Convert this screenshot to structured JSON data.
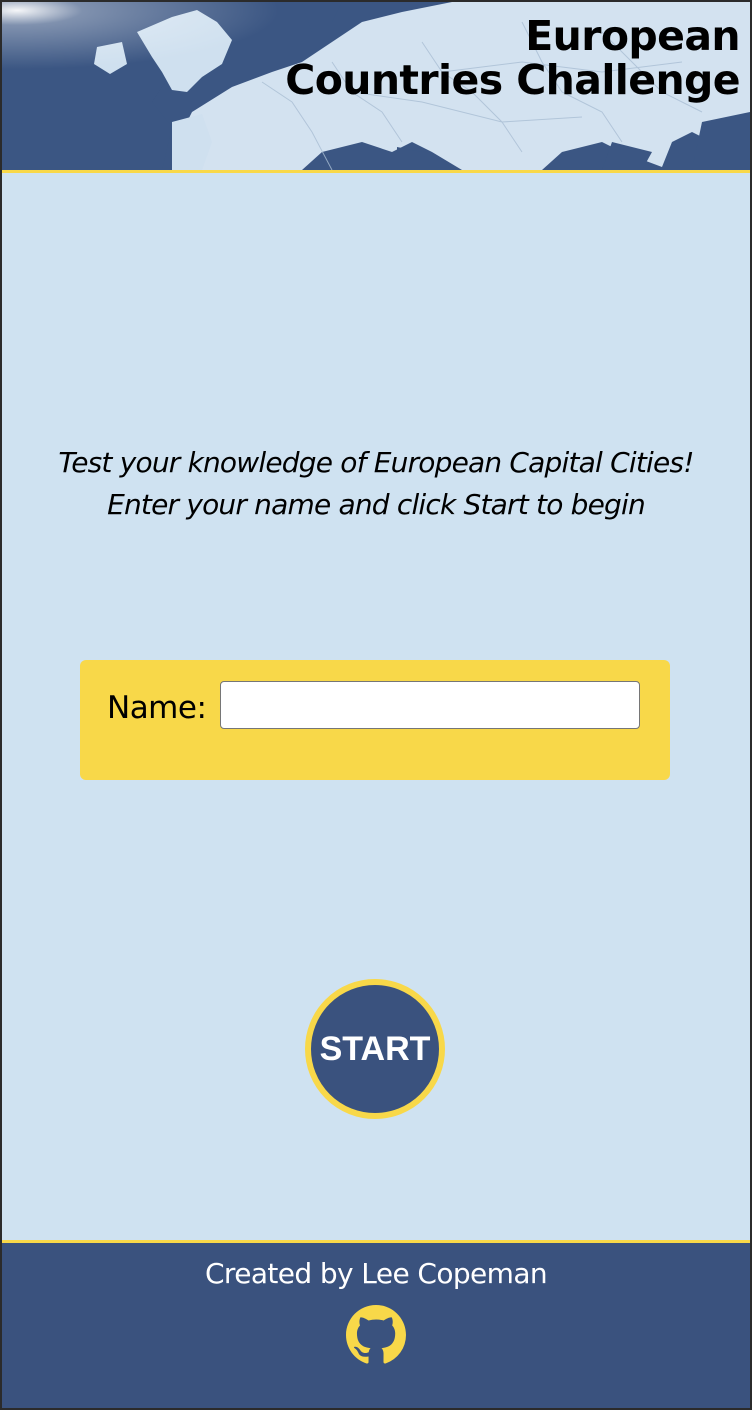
{
  "header": {
    "title_line1": "European",
    "title_line2": "Countries Challenge"
  },
  "intro": {
    "line1": "Test your knowledge of European Capital Cities!",
    "line2": "Enter your name and click Start to begin"
  },
  "name_form": {
    "label": "Name:",
    "value": "",
    "placeholder": ""
  },
  "start_button": {
    "label": "START"
  },
  "footer": {
    "credit": "Created by Lee Copeman",
    "github_icon": "github-icon"
  },
  "colors": {
    "background": "#cfe2f1",
    "accent_yellow": "#f8d849",
    "navy": "#3a527e"
  }
}
